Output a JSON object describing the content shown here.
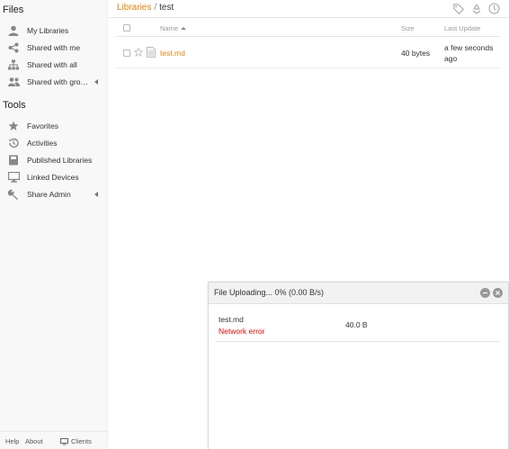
{
  "sidebar": {
    "files_heading": "Files",
    "files_items": [
      {
        "label": "My Libraries",
        "icon": "user-icon"
      },
      {
        "label": "Shared with me",
        "icon": "share-icon"
      },
      {
        "label": "Shared with all",
        "icon": "org-icon"
      },
      {
        "label": "Shared with gro…",
        "icon": "group-icon",
        "expandable": true
      }
    ],
    "tools_heading": "Tools",
    "tools_items": [
      {
        "label": "Favorites",
        "icon": "star-icon"
      },
      {
        "label": "Activities",
        "icon": "history-icon"
      },
      {
        "label": "Published Libraries",
        "icon": "book-icon"
      },
      {
        "label": "Linked Devices",
        "icon": "monitor-icon"
      },
      {
        "label": "Share Admin",
        "icon": "wrench-icon",
        "expandable": true
      }
    ],
    "footer": {
      "help": "Help",
      "about": "About",
      "clients": "Clients"
    }
  },
  "breadcrumb": {
    "root": "Libraries",
    "separator": "/",
    "current": "test"
  },
  "toolbar_icons": [
    "tag-icon",
    "recycle-icon",
    "history-icon"
  ],
  "table": {
    "headers": {
      "name": "Name",
      "size": "Size",
      "last_update": "Last Update"
    },
    "rows": [
      {
        "name": "test.md",
        "size": "40 bytes",
        "last_update": "a few seconds ago"
      }
    ]
  },
  "upload": {
    "title": "File Uploading... 0% (0.00 B/s)",
    "files": [
      {
        "name": "test.md",
        "status": "Network error",
        "size": "40.0 B"
      }
    ]
  },
  "colors": {
    "accent": "#eb8205",
    "error": "#ee0000"
  }
}
